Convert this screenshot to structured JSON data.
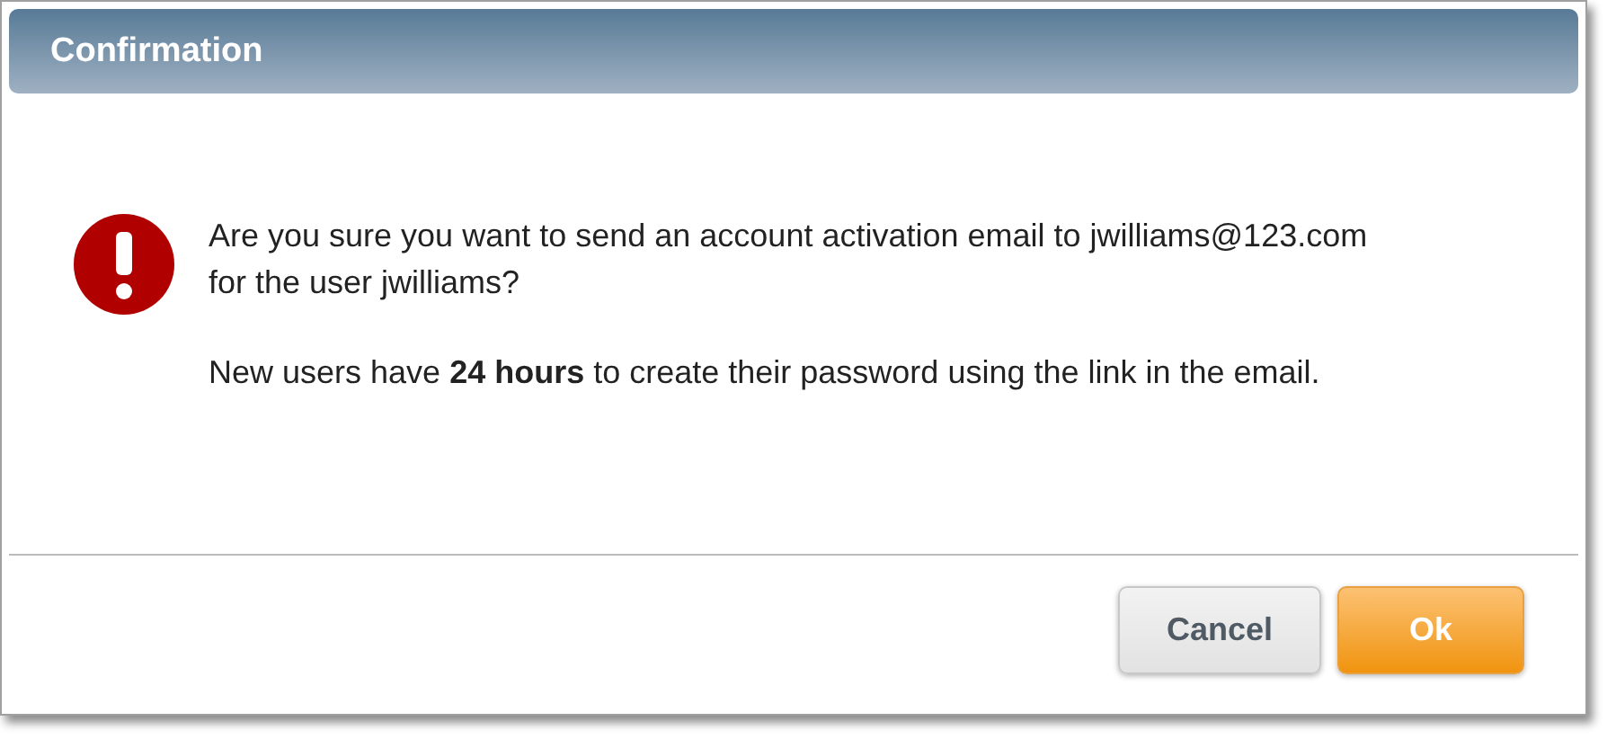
{
  "dialog": {
    "title": "Confirmation",
    "messages": [
      "Are you sure you want to send an account activation email to jwilliams@123.com for the user jwilliams?",
      "New users have **24 hours** to create their password using the link in the email."
    ],
    "buttons": [
      {
        "label": "Cancel",
        "kind": "default"
      },
      {
        "label": "Ok",
        "kind": "primary"
      }
    ]
  }
}
